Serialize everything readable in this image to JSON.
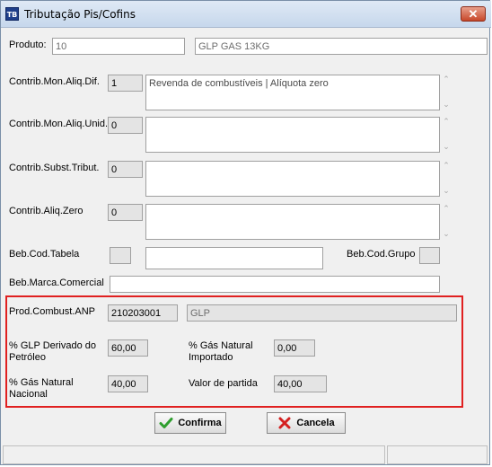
{
  "window": {
    "title": "Tributação Pis/Cofins",
    "icon_text": "TB",
    "close_label": "✕"
  },
  "produto": {
    "label": "Produto:",
    "code": "10",
    "name": "GLP GAS 13KG"
  },
  "mon_aliq_dif": {
    "label": "Contrib.Mon.Aliq.Dif.",
    "code": "1",
    "text": "Revenda de combustíveis | Alíquota zero"
  },
  "mon_aliq_unid": {
    "label": "Contrib.Mon.Aliq.Unid.",
    "code": "0",
    "text": ""
  },
  "subst_tribut": {
    "label": "Contrib.Subst.Tribut.",
    "code": "0",
    "text": ""
  },
  "aliq_zero": {
    "label": "Contrib.Aliq.Zero",
    "code": "0",
    "text": ""
  },
  "bebidas": {
    "tabela_label": "Beb.Cod.Tabela",
    "tabela_value": "",
    "tabela_text": "",
    "grupo_label": "Beb.Cod.Grupo",
    "grupo_value": "",
    "marca_label": "Beb.Marca.Comercial",
    "marca_value": ""
  },
  "anp": {
    "label": "Prod.Combust.ANP",
    "code": "210203001",
    "description": "GLP",
    "glp_derivado_label": "% GLP Derivado do Petróleo",
    "glp_derivado_value": "60,00",
    "gas_importado_label": "% Gás Natural Importado",
    "gas_importado_value": "0,00",
    "gas_nacional_label": "% Gás Natural Nacional",
    "gas_nacional_value": "40,00",
    "valor_partida_label": "Valor de partida",
    "valor_partida_value": "40,00"
  },
  "buttons": {
    "confirma": "Confirma",
    "cancela": "Cancela"
  },
  "icons": {
    "confirm": "check-icon",
    "cancel": "x-icon",
    "scroll_up": "chevron-up-icon",
    "scroll_down": "chevron-down-icon"
  },
  "colors": {
    "highlight_frame": "#e02020",
    "confirm_icon": "#2e9e2e",
    "cancel_icon": "#d42020"
  }
}
